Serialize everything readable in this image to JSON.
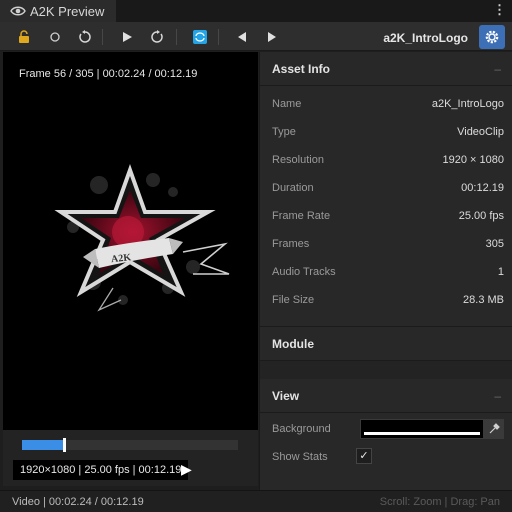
{
  "tab": {
    "title": "A2K Preview",
    "icon": "eye-icon"
  },
  "menu": {
    "icon": "kebab-menu-icon",
    "glyph": "⋮"
  },
  "toolbar": {
    "asset_name": "a2K_IntroLogo",
    "icons": {
      "lock": "lock-icon",
      "record": "circle-icon",
      "reset": "undo-icon",
      "play": "play-icon",
      "restart": "restart-icon",
      "loop": "loop-icon",
      "prev": "previous-icon",
      "next": "next-icon",
      "settings": "gear-icon"
    },
    "accent": "#3d6fb7",
    "loop_color": "#22a4e6",
    "lock_color": "#e0a81c"
  },
  "viewport": {
    "frame_info": "Frame 56 / 305  |  00:02.24 / 00:12.19",
    "logo_text": "A2K"
  },
  "playback": {
    "progress": 0.19,
    "stats": "1920×1080 | 25.00 fps | 00:12.19",
    "scrub_color": "#3a8ee6"
  },
  "status_bar": {
    "left": "Video | 00:02.24 / 00:12.19",
    "right": "Scroll: Zoom | Drag: Pan"
  },
  "panel": {
    "asset_info": {
      "title": "Asset Info",
      "rows": [
        {
          "key": "Name",
          "value": "a2K_IntroLogo"
        },
        {
          "key": "Type",
          "value": "VideoClip"
        },
        {
          "key": "Resolution",
          "value": "1920 × 1080"
        },
        {
          "key": "Duration",
          "value": "00:12.19"
        },
        {
          "key": "Frame Rate",
          "value": "25.00 fps"
        },
        {
          "key": "Frames",
          "value": "305"
        },
        {
          "key": "Audio Tracks",
          "value": "1"
        },
        {
          "key": "File Size",
          "value": "28.3 MB"
        }
      ]
    },
    "module": {
      "title": "Module"
    },
    "view": {
      "title": "View",
      "background_label": "Background",
      "show_stats_label": "Show Stats",
      "show_stats": true
    },
    "collapse_glyph": "–"
  }
}
